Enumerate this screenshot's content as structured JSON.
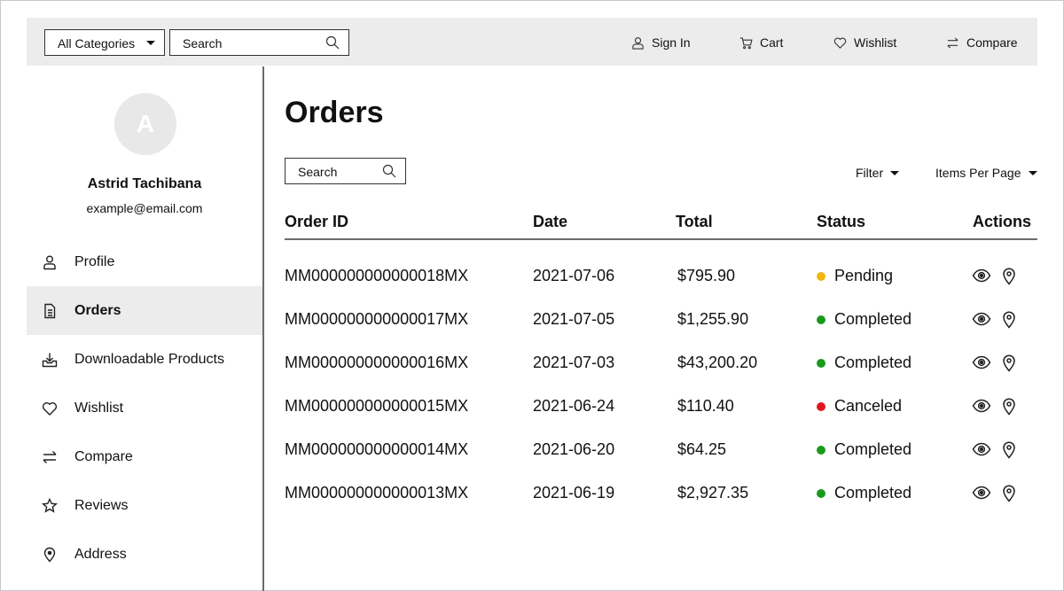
{
  "header": {
    "category_select": "All Categories",
    "search_placeholder": "Search",
    "nav": {
      "sign_in": "Sign In",
      "cart": "Cart",
      "wishlist": "Wishlist",
      "compare": "Compare"
    }
  },
  "sidebar": {
    "avatar_letter": "A",
    "user_name": "Astrid Tachibana",
    "user_email": "example@email.com",
    "items": [
      {
        "label": "Profile",
        "icon": "user-icon",
        "active": false
      },
      {
        "label": "Orders",
        "icon": "document-icon",
        "active": true
      },
      {
        "label": "Downloadable Products",
        "icon": "download-tray-icon",
        "active": false
      },
      {
        "label": "Wishlist",
        "icon": "heart-icon",
        "active": false
      },
      {
        "label": "Compare",
        "icon": "swap-arrows-icon",
        "active": false
      },
      {
        "label": "Reviews",
        "icon": "star-icon",
        "active": false
      },
      {
        "label": "Address",
        "icon": "map-pin-icon",
        "active": false
      }
    ]
  },
  "main": {
    "title": "Orders",
    "search_placeholder": "Search",
    "filter_label": "Filter",
    "items_per_page_label": "Items Per Page",
    "table": {
      "columns": [
        "Order ID",
        "Date",
        "Total",
        "Status",
        "Actions"
      ],
      "rows": [
        {
          "order_id": "MM000000000000018MX",
          "date": "2021-07-06",
          "total": "$795.90",
          "status": "Pending",
          "status_color": "#f2b70f"
        },
        {
          "order_id": "MM000000000000017MX",
          "date": "2021-07-05",
          "total": "$1,255.90",
          "status": "Completed",
          "status_color": "#1a9a1a"
        },
        {
          "order_id": "MM000000000000016MX",
          "date": "2021-07-03",
          "total": "$43,200.20",
          "status": "Completed",
          "status_color": "#1a9a1a"
        },
        {
          "order_id": "MM000000000000015MX",
          "date": "2021-06-24",
          "total": "$110.40",
          "status": "Canceled",
          "status_color": "#e0161e"
        },
        {
          "order_id": "MM000000000000014MX",
          "date": "2021-06-20",
          "total": "$64.25",
          "status": "Completed",
          "status_color": "#1a9a1a"
        },
        {
          "order_id": "MM000000000000013MX",
          "date": "2021-06-19",
          "total": "$2,927.35",
          "status": "Completed",
          "status_color": "#1a9a1a"
        }
      ],
      "action_icons": [
        "eye-icon",
        "map-pin-icon"
      ]
    }
  }
}
